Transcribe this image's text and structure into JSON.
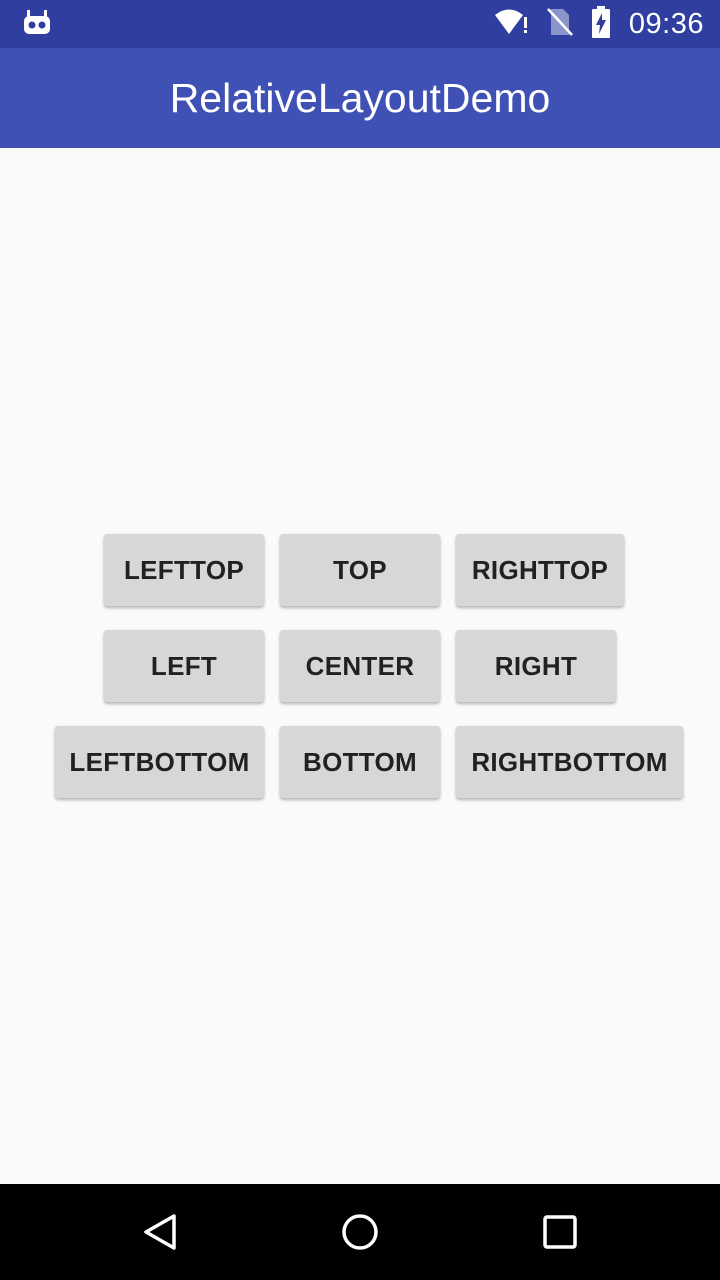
{
  "status_bar": {
    "time": "09:36",
    "icons": [
      "notification-bot-icon",
      "wifi-alert-icon",
      "no-sim-icon",
      "battery-charging-icon"
    ]
  },
  "app_bar": {
    "title": "RelativeLayoutDemo",
    "color": "#3f51b5",
    "status_color": "#303f9f"
  },
  "buttons": {
    "lefttop": "LEFTTOP",
    "top": "TOP",
    "righttop": "RIGHTTOP",
    "left": "LEFT",
    "center": "CENTER",
    "right": "RIGHT",
    "leftbottom": "LEFTBOTTOM",
    "bottom": "BOTTOM",
    "rightbottom": "RIGHTBOTTOM"
  },
  "nav_bar": {
    "icons": [
      "back-icon",
      "home-icon",
      "recents-icon"
    ]
  }
}
